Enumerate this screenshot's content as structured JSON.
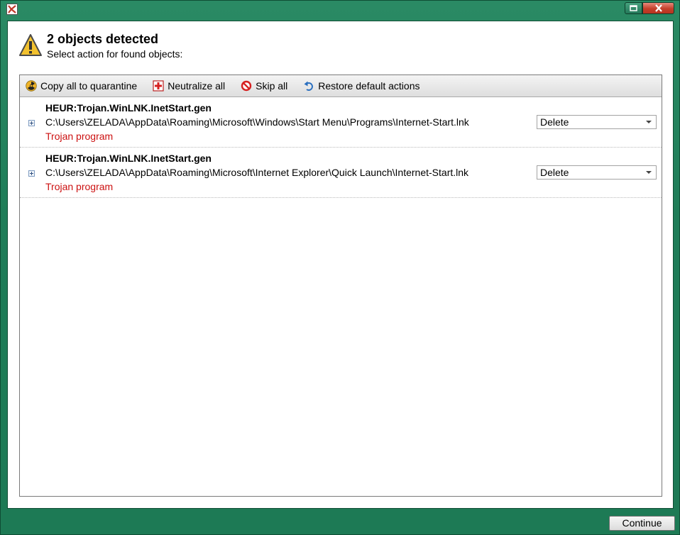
{
  "header": {
    "title": "2 objects detected",
    "subtitle": "Select action for found objects:"
  },
  "toolbar": {
    "copy_all": "Copy all to quarantine",
    "neutralize_all": "Neutralize all",
    "skip_all": "Skip all",
    "restore_defaults": "Restore default actions"
  },
  "objects": [
    {
      "name": "HEUR:Trojan.WinLNK.InetStart.gen",
      "path": "C:\\Users\\ZELADA\\AppData\\Roaming\\Microsoft\\Windows\\Start Menu\\Programs\\Internet-Start.lnk",
      "type": "Trojan program",
      "action": "Delete"
    },
    {
      "name": "HEUR:Trojan.WinLNK.InetStart.gen",
      "path": "C:\\Users\\ZELADA\\AppData\\Roaming\\Microsoft\\Internet Explorer\\Quick Launch\\Internet-Start.lnk",
      "type": "Trojan program",
      "action": "Delete"
    }
  ],
  "footer": {
    "continue_label": "Continue"
  },
  "colors": {
    "frame": "#1f7d58",
    "threat_type": "#cc1111",
    "close_button": "#c4402b"
  },
  "icons": {
    "app": "kaspersky-logo-icon",
    "header": "warning-triangle-icon",
    "copy_all": "radiation-icon",
    "neutralize_all": "red-cross-icon",
    "skip_all": "prohibited-icon",
    "restore_defaults": "undo-arrow-icon"
  }
}
